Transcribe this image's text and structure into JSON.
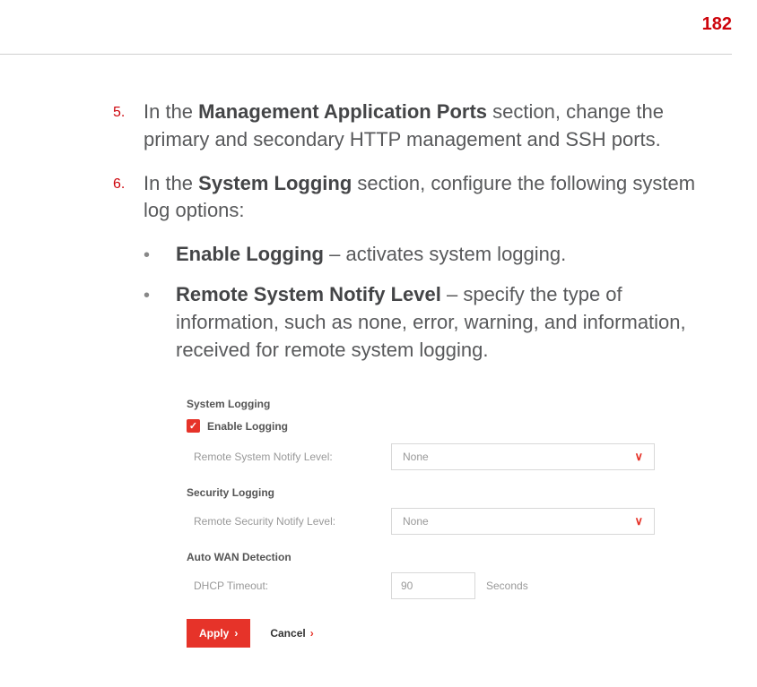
{
  "page_number": "182",
  "steps": [
    {
      "num": "5.",
      "prefix": "In the ",
      "bold1": "Management Application Ports",
      "mid": " section, change the primary and secondary HTTP management and SSH ports.",
      "bold2": "",
      "suffix": ""
    },
    {
      "num": "6.",
      "prefix": "In the ",
      "bold1": "System Logging",
      "mid": " section, configure the following system log options:",
      "bold2": "",
      "suffix": ""
    }
  ],
  "bullets": [
    {
      "bold": "Enable Logging",
      "rest": " – activates system logging."
    },
    {
      "bold": "Remote System Notify Level",
      "rest": " – specify the type of information, such as none, error, warning, and information, received for remote system logging."
    }
  ],
  "screenshot": {
    "system_logging_heading": "System Logging",
    "enable_logging_label": "Enable Logging",
    "remote_system_label": "Remote System Notify Level:",
    "remote_system_value": "None",
    "security_logging_heading": "Security Logging",
    "remote_security_label": "Remote Security Notify Level:",
    "remote_security_value": "None",
    "auto_wan_heading": "Auto WAN Detection",
    "dhcp_timeout_label": "DHCP Timeout:",
    "dhcp_timeout_value": "90",
    "dhcp_timeout_unit": "Seconds",
    "apply_label": "Apply",
    "cancel_label": "Cancel"
  }
}
